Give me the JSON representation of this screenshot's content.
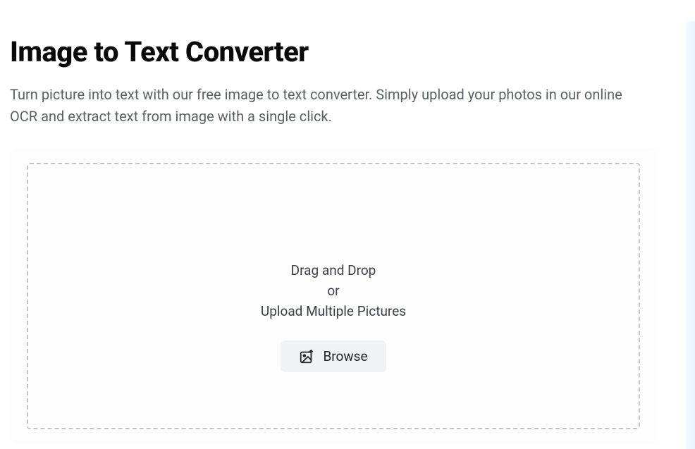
{
  "header": {
    "title": "Image to Text Converter",
    "description": "Turn picture into text with our free image to text converter. Simply upload your photos in our online OCR and extract text from image with a single click."
  },
  "dropzone": {
    "line1": "Drag and Drop",
    "line2": "or",
    "line3": "Upload Multiple Pictures",
    "browse_label": "Browse"
  }
}
